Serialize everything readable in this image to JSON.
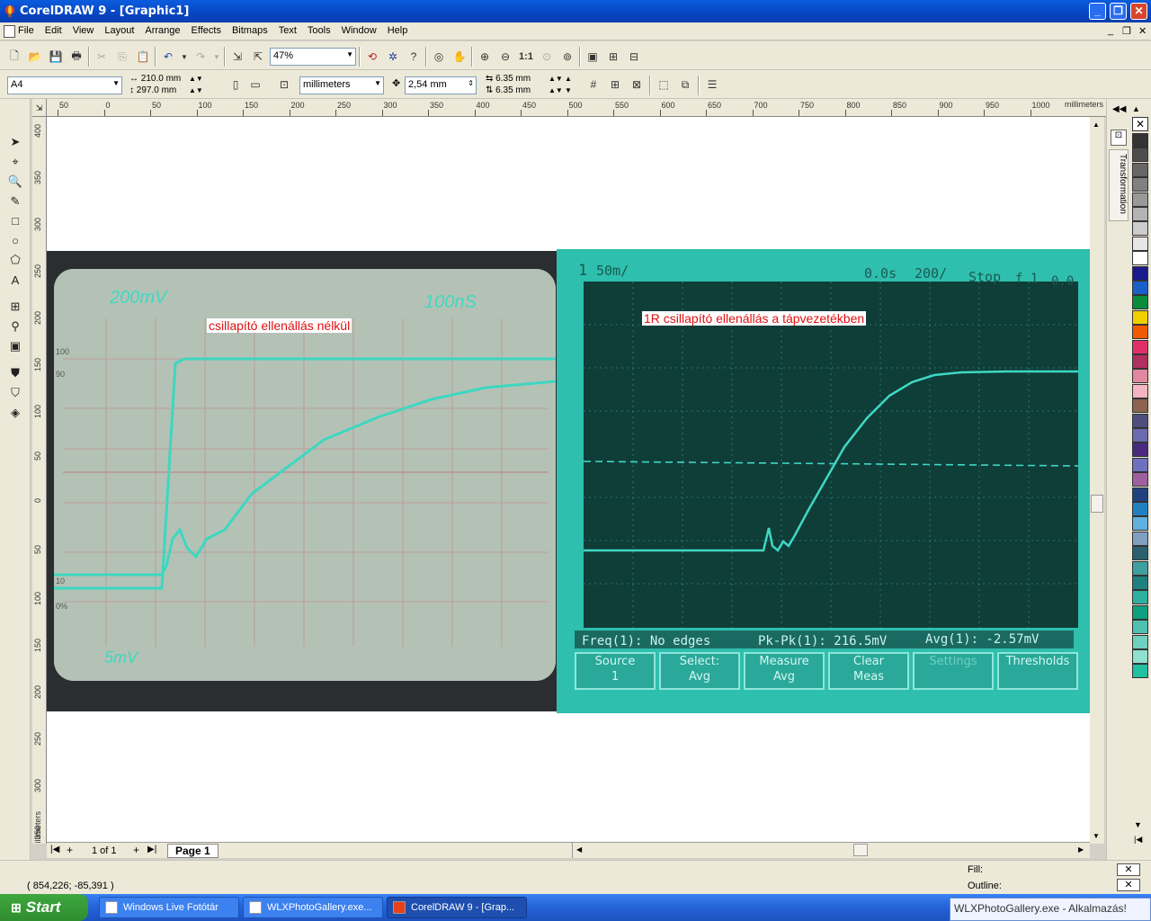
{
  "window": {
    "title": "CorelDRAW 9 - [Graphic1]"
  },
  "menu": [
    "File",
    "Edit",
    "View",
    "Layout",
    "Arrange",
    "Effects",
    "Bitmaps",
    "Text",
    "Tools",
    "Window",
    "Help"
  ],
  "toolbar": {
    "zoom": "47%"
  },
  "propertybar": {
    "paper": "A4",
    "width": "210.0 mm",
    "height": "297.0 mm",
    "units": "millimeters",
    "nudge": "2,54 mm",
    "dup_x": "6.35 mm",
    "dup_y": "6.35 mm"
  },
  "ruler": {
    "units": "millimeters",
    "h_ticks": [
      "50",
      "0",
      "50",
      "100",
      "150",
      "200",
      "250",
      "300",
      "350",
      "400",
      "450",
      "500",
      "550",
      "600",
      "650",
      "700",
      "750",
      "800",
      "850",
      "900",
      "950",
      "1000"
    ],
    "v_ticks": [
      "400",
      "350",
      "300",
      "250",
      "200",
      "150",
      "100",
      "50",
      "0",
      "50",
      "100",
      "150",
      "200",
      "250",
      "300",
      "350"
    ],
    "v_units": "millimeters"
  },
  "docker": {
    "tab": "Transformation"
  },
  "canvas": {
    "caption_left": "csillapító ellenállás nélkül",
    "caption_right": "1R csillapító ellenállás  a tápvezetékben",
    "osc_left": {
      "volts": "200mV",
      "time": "100nS",
      "mv": "5mV",
      "pct100": "100",
      "pct90": "90",
      "pct10": "10",
      "pct0": "0%"
    },
    "osc_right": {
      "ch": "1",
      "scale": "50m/",
      "time": "0.0s",
      "rate": "200/",
      "stop": "Stop",
      "trig": "f 1",
      "trig_val": "0.0",
      "freq": "Freq(1): No edges",
      "pkpk": "Pk-Pk(1): 216.5mV",
      "avg": "Avg(1): -2.57mV",
      "softkeys": [
        {
          "l1": "Source",
          "l2": "1"
        },
        {
          "l1": "Select:",
          "l2": "Avg"
        },
        {
          "l1": "Measure",
          "l2": "Avg"
        },
        {
          "l1": "Clear",
          "l2": "Meas"
        },
        {
          "l1": "Settings",
          "l2": ""
        },
        {
          "l1": "Thresholds",
          "l2": ""
        }
      ]
    }
  },
  "pages": {
    "counter": "1 of 1",
    "tab": "Page 1"
  },
  "status": {
    "coords": "( 854,226; -85,391 )",
    "fill_label": "Fill:",
    "outline_label": "Outline:"
  },
  "taskbar": {
    "start": "Start",
    "tasks": [
      "Windows Live Fotótár",
      "WLXPhotoGallery.exe...",
      "CorelDRAW 9 - [Grap..."
    ],
    "notification": "WLXPhotoGallery.exe - Alkalmazás!"
  },
  "palette_colors": [
    "#333333",
    "#4d4d4d",
    "#666666",
    "#808080",
    "#999999",
    "#b3b3b3",
    "#cccccc",
    "#e6e6e6",
    "#ffffff",
    "#1a1a8c",
    "#1b5fc9",
    "#0a8c3c",
    "#f0d000",
    "#f05a00",
    "#e0306a",
    "#b03060",
    "#e088a0",
    "#f4b4c0",
    "#8c6450",
    "#4d4d80",
    "#6a6ab0",
    "#4a2a80",
    "#7070c0",
    "#a060a0",
    "#204080",
    "#2080c0",
    "#60b0e0",
    "#80a0c0",
    "#2a6070",
    "#40a0a0",
    "#208080",
    "#30b0a0",
    "#10a080",
    "#50c0b0",
    "#70d0c0",
    "#90e0d0",
    "#20c0a0"
  ]
}
